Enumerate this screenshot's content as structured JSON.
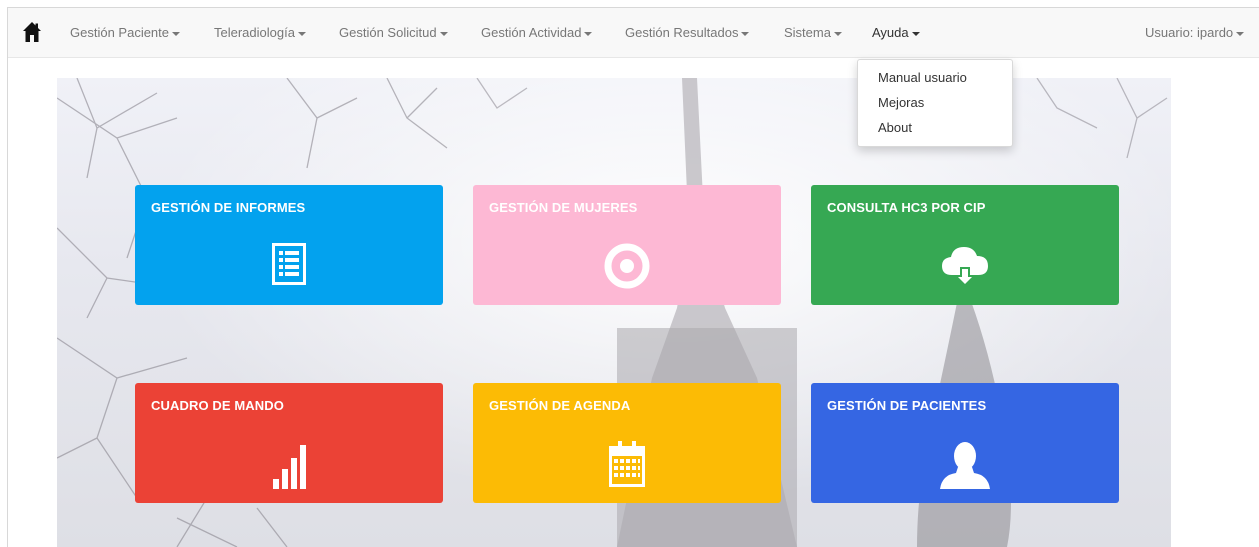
{
  "navbar": {
    "home_icon": "home-icon",
    "menus": [
      {
        "label": "Gestión Paciente"
      },
      {
        "label": "Teleradiología"
      },
      {
        "label": "Gestión Solicitud"
      },
      {
        "label": "Gestión Actividad"
      },
      {
        "label": "Gestión Resultados"
      },
      {
        "label": "Sistema"
      },
      {
        "label": "Ayuda",
        "active": true
      }
    ],
    "user_label": "Usuario: ipardo"
  },
  "help_dropdown": {
    "items": [
      {
        "label": "Manual usuario"
      },
      {
        "label": "Mejoras"
      },
      {
        "label": "About"
      }
    ]
  },
  "tiles": [
    {
      "title": "GESTIÓN DE INFORMES",
      "color": "#03a2ee",
      "icon": "report-list-icon"
    },
    {
      "title": "GESTIÓN DE MUJERES",
      "color": "#fdb8d4",
      "icon": "target-icon"
    },
    {
      "title": "CONSULTA HC3 POR CIP",
      "color": "#36a853",
      "icon": "cloud-download-icon"
    },
    {
      "title": "CUADRO DE MANDO",
      "color": "#eb4236",
      "icon": "bar-signal-icon"
    },
    {
      "title": "GESTIÓN DE AGENDA",
      "color": "#fcbb05",
      "icon": "calendar-icon"
    },
    {
      "title": "GESTIÓN DE PACIENTES",
      "color": "#3566e3",
      "icon": "user-icon"
    }
  ]
}
